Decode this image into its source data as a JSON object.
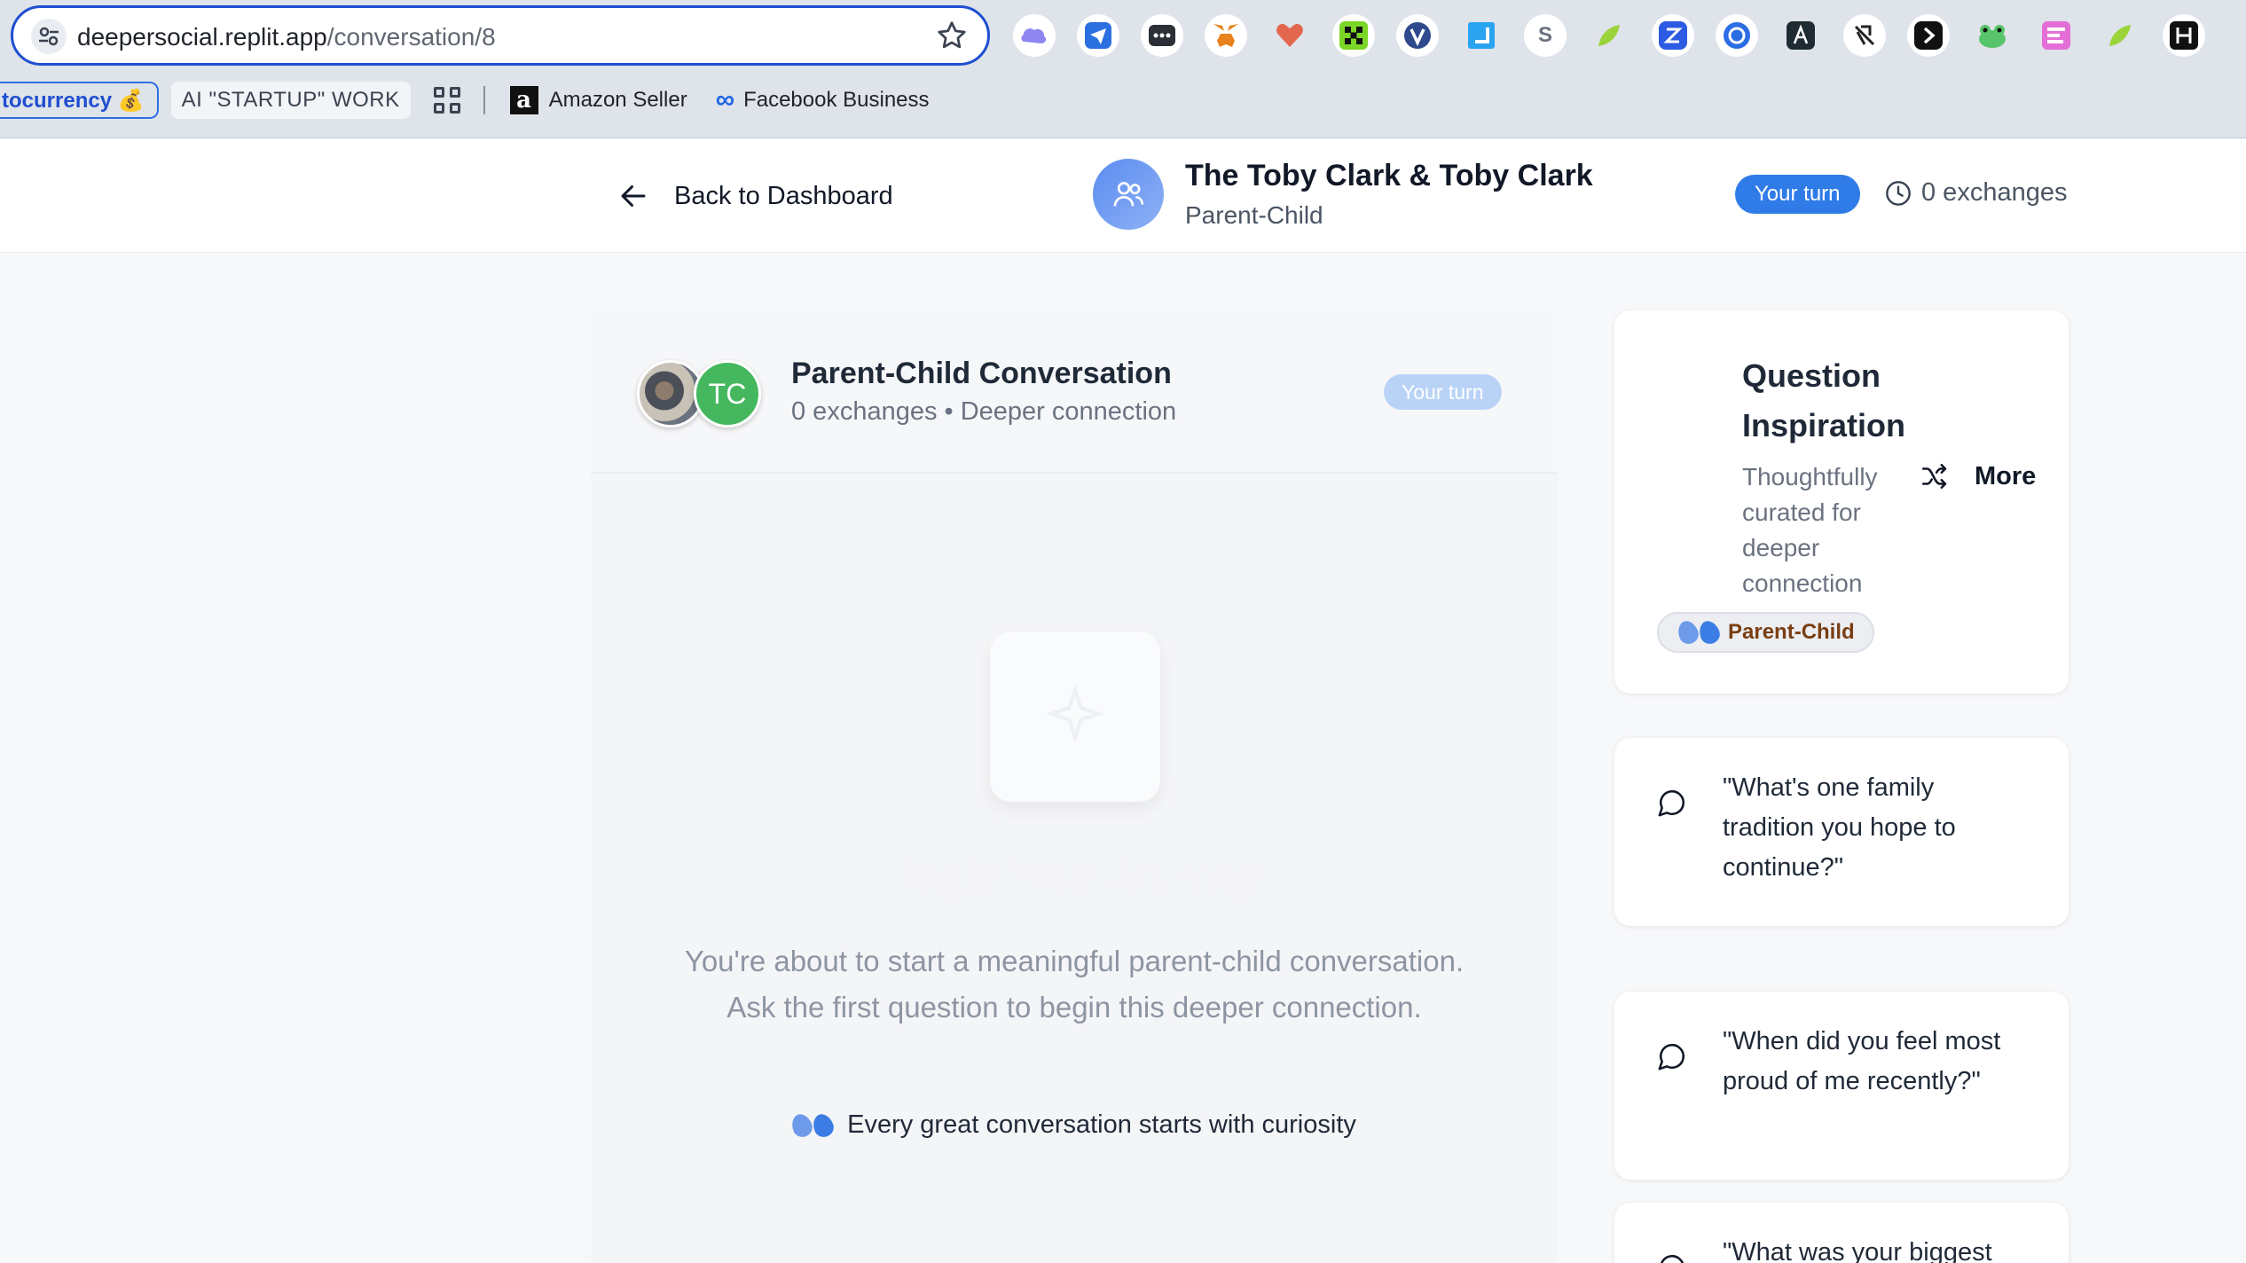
{
  "browser": {
    "url_host": "deepersocial.replit.app",
    "url_path": "/conversation/8",
    "extensions": [
      "cloud-extension",
      "send-extension",
      "password-extension",
      "metamask-extension",
      "heart-extension",
      "grid-extension",
      "v-extension",
      "blue-square-extension",
      "s-extension",
      "leaf-extension",
      "z-extension",
      "shield-extension",
      "a-extension",
      "bird-extension",
      "arrow-extension",
      "frog-extension",
      "columns-extension",
      "leaf2-extension",
      "bracket-extension"
    ],
    "bookmarks": {
      "crypto": "tocurrency 💰",
      "startup": "AI \"STARTUP\" WORK",
      "amazon": "Amazon Seller",
      "facebook": "Facebook Business"
    }
  },
  "header": {
    "back_label": "Back to Dashboard",
    "title": "The Toby Clark & Toby Clark",
    "subtitle": "Parent-Child",
    "turn_label": "Your turn",
    "exchanges_label": "0 exchanges"
  },
  "conversation": {
    "avatar_initials": "TC",
    "title": "Parent-Child Conversation",
    "meta": "0 exchanges • Deeper connection",
    "turn_label": "Your turn",
    "empty_title": "Begin Your Journey",
    "empty_text": "You're about to start a meaningful parent-child conversation. Ask the first question to begin this deeper connection.",
    "footer_note": "Every great conversation starts with curiosity"
  },
  "inspiration": {
    "title": "Question Inspiration",
    "subtitle": "Thoughtfully curated for deeper connection",
    "more_label": "More",
    "tag_label": "Parent-Child",
    "questions": [
      "\"What's one family tradition you hope to continue?\"",
      "\"When did you feel most proud of me recently?\"",
      "\"What was your biggest"
    ]
  },
  "colors": {
    "accent": "#2f7be8",
    "tc_avatar": "#45b85f",
    "tag_text": "#7a3e12"
  }
}
